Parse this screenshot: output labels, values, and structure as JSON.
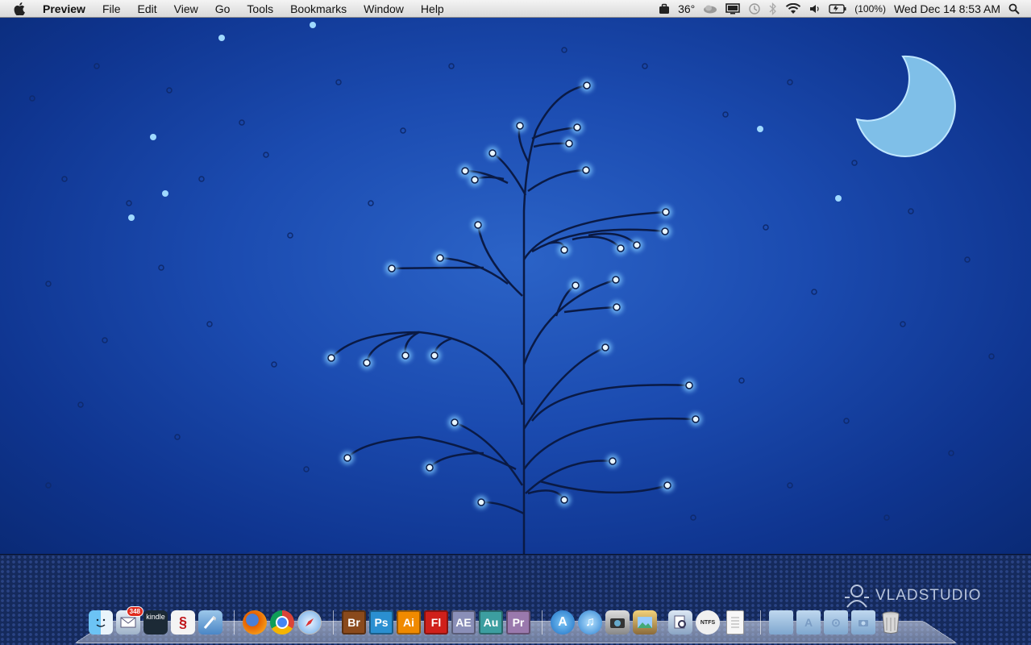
{
  "menubar": {
    "app_name": "Preview",
    "items": [
      "File",
      "Edit",
      "View",
      "Go",
      "Tools",
      "Bookmarks",
      "Window",
      "Help"
    ],
    "status": {
      "temperature": "36°",
      "battery": "(100%)",
      "datetime": "Wed Dec 14  8:53 AM"
    }
  },
  "desktop": {
    "watermark": "VLADSTUDIO",
    "wallpaper_colors": {
      "sky": "#1b4bb0",
      "moon": "#8ec9ef",
      "tree": "#0c1e4a",
      "glow": "#bfe6ff"
    }
  },
  "dock": {
    "mail_badge": "348",
    "kindle_label": "kindle",
    "apps": [
      {
        "name": "finder",
        "icon": "finder-icon"
      },
      {
        "name": "mail",
        "icon": "mail-icon"
      },
      {
        "name": "kindle",
        "icon": "kindle-icon"
      },
      {
        "name": "sbp",
        "icon": "sbp-icon"
      },
      {
        "name": "xcode",
        "icon": "xcode-icon"
      },
      {
        "name": "firefox",
        "icon": "firefox-icon"
      },
      {
        "name": "chrome",
        "icon": "chrome-icon"
      },
      {
        "name": "safari",
        "icon": "safari-icon"
      },
      {
        "name": "bridge",
        "label": "Br",
        "color": "#8a4a1c"
      },
      {
        "name": "photoshop",
        "label": "Ps",
        "color": "#2a8fd1"
      },
      {
        "name": "illustrator",
        "label": "Ai",
        "color": "#f08a00"
      },
      {
        "name": "flash",
        "label": "Fl",
        "color": "#d0201b"
      },
      {
        "name": "after-effects",
        "label": "AE",
        "color": "#8a8fb8"
      },
      {
        "name": "audition",
        "label": "Au",
        "color": "#3c9ea0"
      },
      {
        "name": "premiere",
        "label": "Pr",
        "color": "#9a79ad"
      },
      {
        "name": "app-store",
        "icon": "app-store-icon"
      },
      {
        "name": "itunes",
        "icon": "itunes-icon"
      },
      {
        "name": "image-capture",
        "icon": "image-capture-icon"
      },
      {
        "name": "iphoto",
        "icon": "iphoto-icon"
      },
      {
        "name": "preview",
        "icon": "preview-icon"
      },
      {
        "name": "ntfs",
        "icon": "ntfs-icon",
        "label": "NTFS"
      },
      {
        "name": "text-file",
        "icon": "document-icon"
      },
      {
        "name": "folder-1",
        "icon": "folder-icon"
      },
      {
        "name": "folder-applications",
        "icon": "applications-folder-icon"
      },
      {
        "name": "folder-downloads",
        "icon": "downloads-folder-icon"
      },
      {
        "name": "folder-pictures",
        "icon": "pictures-folder-icon"
      },
      {
        "name": "trash",
        "icon": "trash-icon"
      }
    ]
  }
}
